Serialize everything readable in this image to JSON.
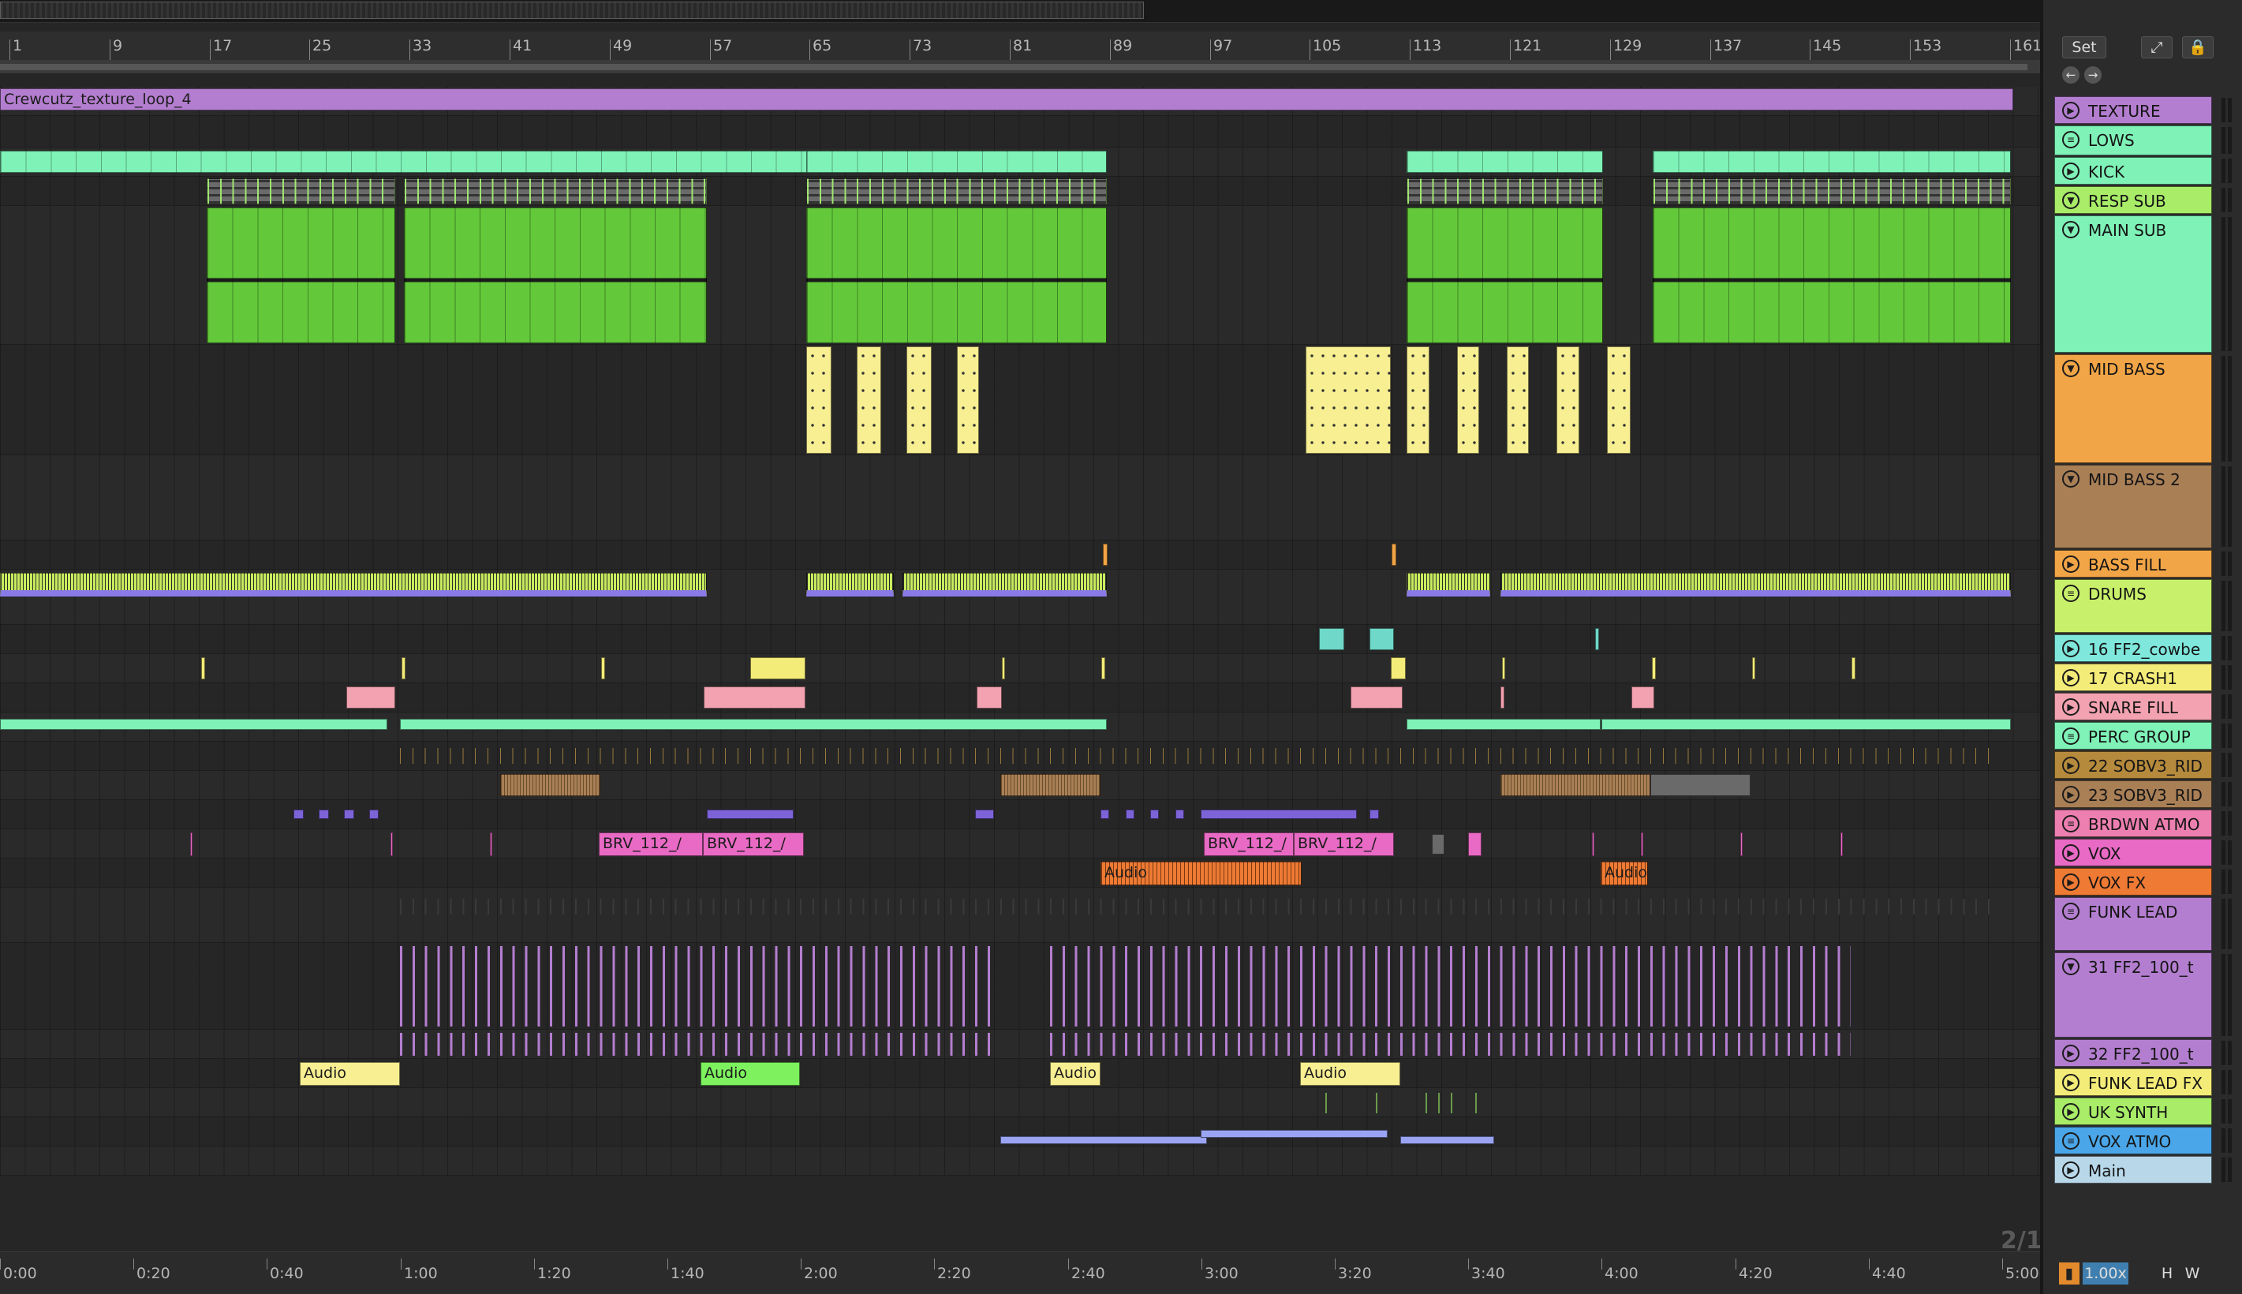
{
  "panel": {
    "set_label": "Set",
    "expand_icon": "expand-icon",
    "lock_icon": "lock-icon",
    "zoom_value": "1.00x",
    "h_label": "H",
    "w_label": "W"
  },
  "hzoom_label": "2/1",
  "ruler": {
    "bars": [
      "1",
      "9",
      "17",
      "25",
      "33",
      "41",
      "49",
      "57",
      "65",
      "73",
      "81",
      "89",
      "97",
      "105",
      "113",
      "121",
      "129",
      "137",
      "145",
      "153",
      "161"
    ]
  },
  "time_ruler": {
    "labels": [
      "0:00",
      "0:20",
      "0:40",
      "1:00",
      "1:20",
      "1:40",
      "2:00",
      "2:20",
      "2:40",
      "3:00",
      "3:20",
      "3:40",
      "4:00",
      "4:20",
      "4:40",
      "5:00"
    ]
  },
  "tracks": [
    {
      "name": "TEXTURE",
      "color": "#b47ed0",
      "kind": "play",
      "clips": [
        {
          "label": "Crewcutz_texture_loop_4"
        }
      ]
    },
    {
      "name": "LOWS",
      "color": "#7ff2b7",
      "kind": "group"
    },
    {
      "name": "KICK",
      "color": "#7ff2b7",
      "kind": "play"
    },
    {
      "name": "RESP SUB",
      "color": "#a8ec68",
      "kind": "fold"
    },
    {
      "name": "MAIN SUB",
      "color": "#7ff2b7",
      "kind": "fold"
    },
    {
      "name": "MID BASS",
      "color": "#f2a546",
      "kind": "fold"
    },
    {
      "name": "MID BASS 2",
      "color": "#a97f56",
      "kind": "fold"
    },
    {
      "name": "BASS FILL",
      "color": "#f2a546",
      "kind": "play"
    },
    {
      "name": "DRUMS",
      "color": "#c9f06a",
      "kind": "group"
    },
    {
      "name": "16 FF2_cowbe",
      "color": "#7fe7dc",
      "kind": "play"
    },
    {
      "name": "17 CRASH1",
      "color": "#f4ec78",
      "kind": "play"
    },
    {
      "name": "SNARE FILL",
      "color": "#f2a2b0",
      "kind": "play"
    },
    {
      "name": "PERC GROUP",
      "color": "#7ff2b7",
      "kind": "group"
    },
    {
      "name": "22 SOBV3_RID",
      "color": "#b68a3c",
      "kind": "play"
    },
    {
      "name": "23 SOBV3_RID",
      "color": "#a97f56",
      "kind": "play"
    },
    {
      "name": "BRDWN ATMO",
      "color": "#ec7fb0",
      "kind": "group"
    },
    {
      "name": "VOX",
      "color": "#e86ac4",
      "kind": "play",
      "clips": [
        {
          "label": "BRV_112_/"
        },
        {
          "label": "BRV_112_/"
        },
        {
          "label": "BRV_112_/"
        },
        {
          "label": "BRV_112_/"
        }
      ]
    },
    {
      "name": "VOX FX",
      "color": "#ee7a34",
      "kind": "play",
      "clips": [
        {
          "label": "Audio"
        },
        {
          "label": "Audio"
        }
      ]
    },
    {
      "name": "FUNK LEAD",
      "color": "#b47ed0",
      "kind": "group"
    },
    {
      "name": "31 FF2_100_t",
      "color": "#b47ed0",
      "kind": "fold"
    },
    {
      "name": "32 FF2_100_t",
      "color": "#b47ed0",
      "kind": "play"
    },
    {
      "name": "FUNK LEAD FX",
      "color": "#f4ec78",
      "kind": "play",
      "clips": [
        {
          "label": "Audio"
        },
        {
          "label": "Audio"
        },
        {
          "label": "Audio"
        },
        {
          "label": "Audio"
        }
      ]
    },
    {
      "name": "UK SYNTH",
      "color": "#a8ec68",
      "kind": "play"
    },
    {
      "name": "VOX ATMO",
      "color": "#4aa6e8",
      "kind": "group"
    },
    {
      "name": "Main",
      "color": "#b8d8ea",
      "kind": "play"
    }
  ],
  "colors": {
    "arrangement_bg": "#262626",
    "panel_bg": "#2b2b2b",
    "zoom_highlight": "#3f7fb0"
  }
}
